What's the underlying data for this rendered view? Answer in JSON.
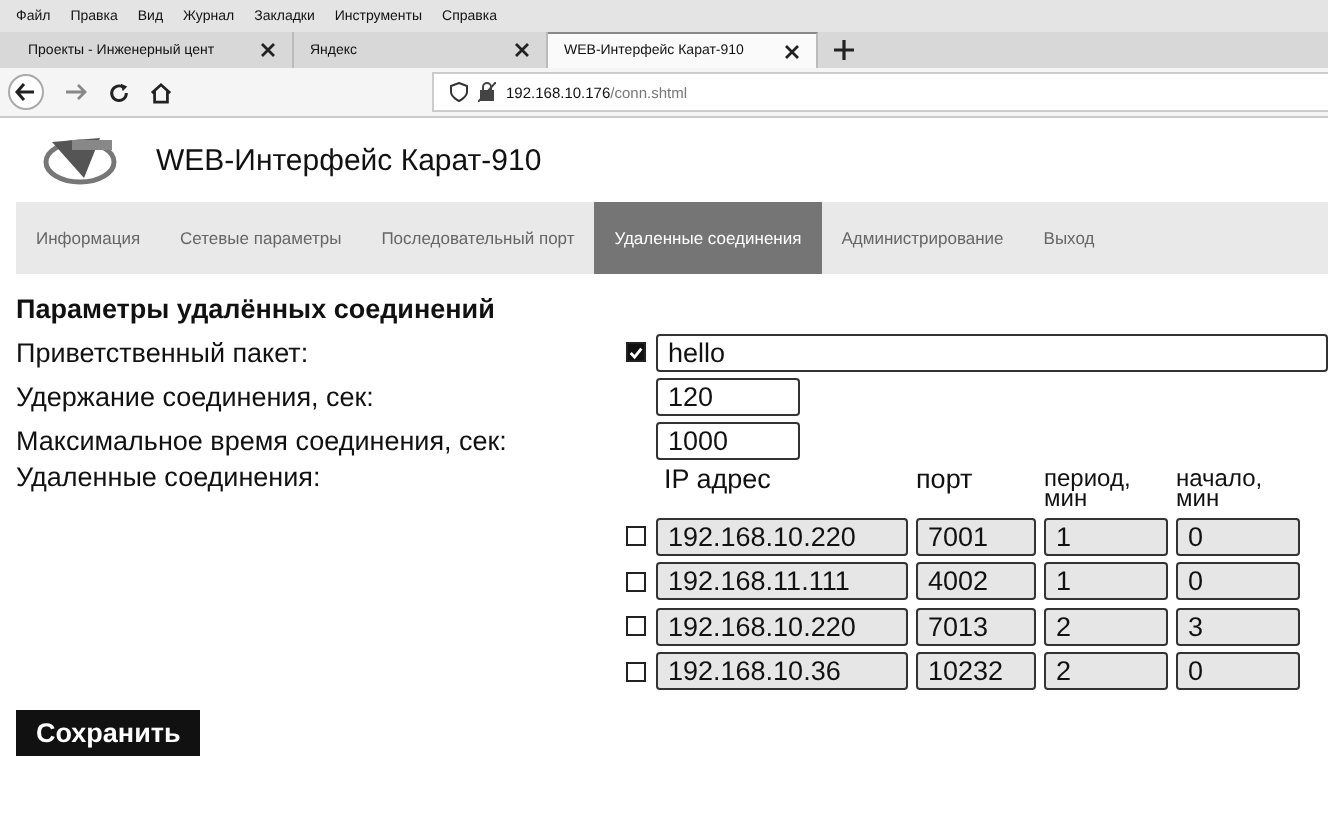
{
  "browser": {
    "menu": [
      "Файл",
      "Правка",
      "Вид",
      "Журнал",
      "Закладки",
      "Инструменты",
      "Справка"
    ],
    "tabs": [
      {
        "label": "Проекты - Инженерный цент",
        "selected": false
      },
      {
        "label": "Яндекс",
        "selected": false
      },
      {
        "label": "WEB-Интерфейс Карат-910",
        "selected": true
      }
    ],
    "url_host": "192.168.10.176",
    "url_path": "/conn.shtml"
  },
  "header": {
    "title": "WEB-Интерфейс Карат-910"
  },
  "nav": [
    {
      "label": "Информация",
      "selected": false
    },
    {
      "label": "Сетевые параметры",
      "selected": false
    },
    {
      "label": "Последовательный порт",
      "selected": false
    },
    {
      "label": "Удаленные соединения",
      "selected": true
    },
    {
      "label": "Администрирование",
      "selected": false
    },
    {
      "label": "Выход",
      "selected": false
    }
  ],
  "form": {
    "title": "Параметры удалённых соединений",
    "greeting": {
      "label": "Приветственный пакет:",
      "checked": true,
      "value": "hello"
    },
    "hold": {
      "label": "Удержание соединения, сек:",
      "value": "120"
    },
    "max_time": {
      "label": "Максимальное время соединения, сек:",
      "value": "1000"
    },
    "remote": {
      "label": "Удаленные соединения:",
      "columns": [
        "IP адрес",
        "порт",
        "период, мин",
        "начало, мин"
      ],
      "rows": [
        {
          "checked": false,
          "ip": "192.168.10.220",
          "port": "7001",
          "period": "1",
          "start": "0"
        },
        {
          "checked": false,
          "ip": "192.168.11.111",
          "port": "4002",
          "period": "1",
          "start": "0"
        },
        {
          "checked": false,
          "ip": "192.168.10.220",
          "port": "7013",
          "period": "2",
          "start": "3"
        },
        {
          "checked": false,
          "ip": "192.168.10.36",
          "port": "10232",
          "period": "2",
          "start": "0"
        }
      ]
    }
  },
  "save_button": "Сохранить"
}
